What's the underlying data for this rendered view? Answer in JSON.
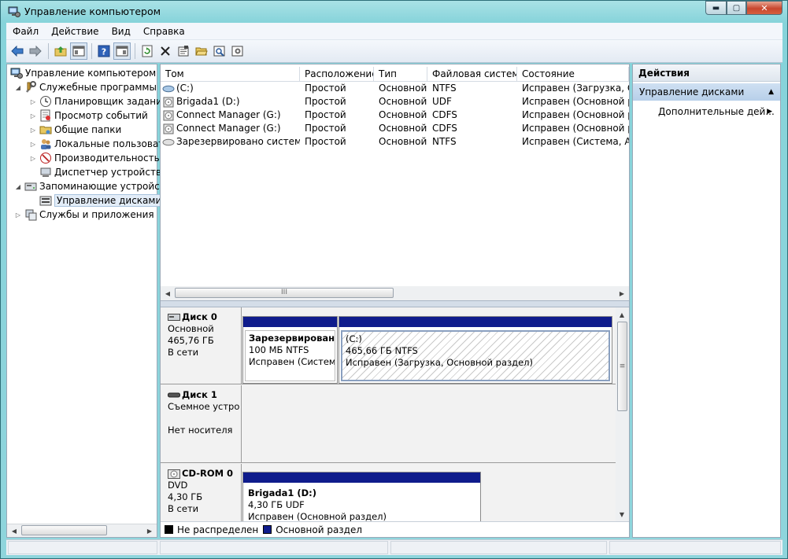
{
  "window": {
    "title": "Управление компьютером",
    "buttons": {
      "minimize": "▬",
      "maximize": "▢",
      "close": "✕"
    }
  },
  "menu": [
    "Файл",
    "Действие",
    "Вид",
    "Справка"
  ],
  "toolbar": {
    "icons": [
      "back-arrow-icon",
      "forward-arrow-icon",
      "folder-up-icon",
      "show-hide-tree-icon",
      "help-icon",
      "console-icon",
      "refresh-icon",
      "delete-icon",
      "properties-icon",
      "open-icon",
      "search-disk-icon",
      "settings-icon"
    ]
  },
  "tree": {
    "items": [
      {
        "label": "Управление компьютером (л",
        "icon": "computer-icon",
        "toggle": ""
      },
      {
        "label": "Служебные программы",
        "icon": "tools-icon",
        "toggle": "◢"
      },
      {
        "label": "Планировщик заданий",
        "icon": "clock-icon",
        "toggle": "▷"
      },
      {
        "label": "Просмотр событий",
        "icon": "event-viewer-icon",
        "toggle": "▷"
      },
      {
        "label": "Общие папки",
        "icon": "shared-folder-icon",
        "toggle": "▷"
      },
      {
        "label": "Локальные пользовате",
        "icon": "users-icon",
        "toggle": "▷"
      },
      {
        "label": "Производительность",
        "icon": "performance-icon",
        "toggle": "▷"
      },
      {
        "label": "Диспетчер устройств",
        "icon": "device-manager-icon",
        "toggle": ""
      },
      {
        "label": "Запоминающие устройст",
        "icon": "storage-icon",
        "toggle": "◢"
      },
      {
        "label": "Управление дисками",
        "icon": "disk-management-icon",
        "toggle": ""
      },
      {
        "label": "Службы и приложения",
        "icon": "services-icon",
        "toggle": "▷"
      }
    ]
  },
  "volumes": {
    "columns": [
      "Том",
      "Расположение",
      "Тип",
      "Файловая система",
      "Состояние"
    ],
    "rows": [
      {
        "name": "(C:)",
        "icon": "drive-icon",
        "layout": "Простой",
        "type": "Основной",
        "fs": "NTFS",
        "status": "Исправен (Загрузка, Осн"
      },
      {
        "name": "Brigada1 (D:)",
        "icon": "cd-icon",
        "layout": "Простой",
        "type": "Основной",
        "fs": "UDF",
        "status": "Исправен (Основной ра"
      },
      {
        "name": "Connect Manager (G:)",
        "icon": "cd-icon",
        "layout": "Простой",
        "type": "Основной",
        "fs": "CDFS",
        "status": "Исправен (Основной ра"
      },
      {
        "name": "Connect Manager (G:)",
        "icon": "cd-icon",
        "layout": "Простой",
        "type": "Основной",
        "fs": "CDFS",
        "status": "Исправен (Основной ра"
      },
      {
        "name": "Зарезервировано системой",
        "icon": "drive-icon",
        "layout": "Простой",
        "type": "Основной",
        "fs": "NTFS",
        "status": "Исправен (Система, Акти"
      }
    ],
    "scroll_thumb": "III"
  },
  "disks": [
    {
      "name": "Диск 0",
      "kind": "Основной",
      "size": "465,76 ГБ",
      "state": "В сети",
      "partitions": [
        {
          "title": "Зарезервировано",
          "size": "100 МБ NTFS",
          "status": "Исправен (Система"
        },
        {
          "title": "(C:)",
          "size": "465,66 ГБ NTFS",
          "status": "Исправен (Загрузка, Основной раздел)"
        }
      ]
    },
    {
      "name": "Диск 1",
      "kind": "Съемное устро",
      "size": "",
      "state": "Нет носителя",
      "partitions": []
    },
    {
      "name": "CD-ROM 0",
      "kind": "DVD",
      "size": "4,30 ГБ",
      "state": "В сети",
      "partitions": [
        {
          "title": "Brigada1  (D:)",
          "size": "4,30 ГБ UDF",
          "status": "Исправен (Основной раздел)"
        }
      ]
    }
  ],
  "legend": [
    {
      "label": "Не распределен",
      "color": "#000000"
    },
    {
      "label": "Основной раздел",
      "color": "#0f1c8c"
    }
  ],
  "actions": {
    "header": "Действия",
    "section": "Управление дисками",
    "item": "Дополнительные дей..."
  },
  "scroll": {
    "thumb_glyph": "≡"
  }
}
